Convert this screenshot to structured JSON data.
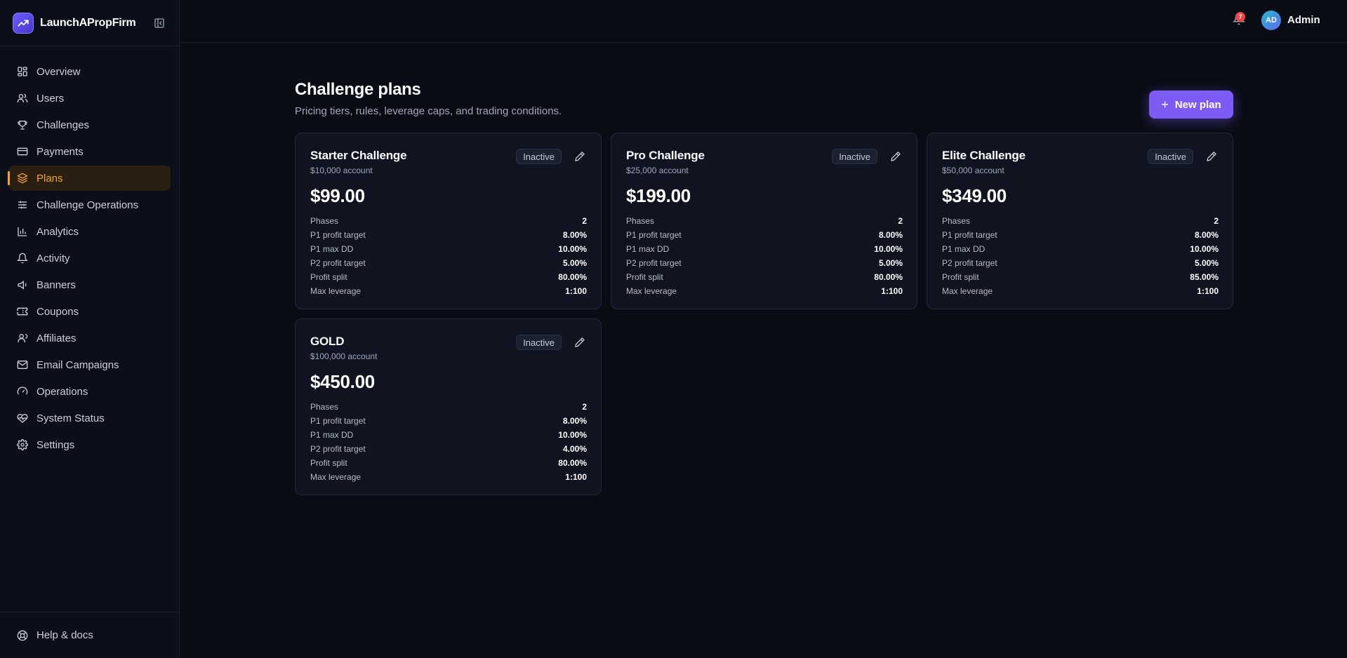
{
  "brand": {
    "name": "LaunchAPropFirm"
  },
  "sidebar": {
    "items": [
      {
        "label": "Overview",
        "icon": "grid-icon"
      },
      {
        "label": "Users",
        "icon": "users-icon"
      },
      {
        "label": "Challenges",
        "icon": "trophy-icon"
      },
      {
        "label": "Payments",
        "icon": "credit-card-icon"
      },
      {
        "label": "Plans",
        "icon": "layers-icon",
        "active": true
      },
      {
        "label": "Challenge Operations",
        "icon": "sliders-icon"
      },
      {
        "label": "Analytics",
        "icon": "bar-chart-icon"
      },
      {
        "label": "Activity",
        "icon": "bell-icon"
      },
      {
        "label": "Banners",
        "icon": "megaphone-icon"
      },
      {
        "label": "Coupons",
        "icon": "ticket-icon"
      },
      {
        "label": "Affiliates",
        "icon": "user-group-icon"
      },
      {
        "label": "Email Campaigns",
        "icon": "mail-icon"
      },
      {
        "label": "Operations",
        "icon": "gauge-icon"
      },
      {
        "label": "System Status",
        "icon": "heart-pulse-icon"
      },
      {
        "label": "Settings",
        "icon": "gear-icon"
      }
    ],
    "help_label": "Help & docs"
  },
  "topbar": {
    "notification_count": "7",
    "avatar_initials": "AD",
    "user_name": "Admin"
  },
  "main": {
    "title": "Challenge plans",
    "subtitle": "Pricing tiers, rules, leverage caps, and trading conditions.",
    "new_plan_label": "New plan",
    "plans": [
      {
        "name": "Starter Challenge",
        "account": "$10,000 account",
        "status": "Inactive",
        "price": "$99.00",
        "rows": [
          {
            "label": "Phases",
            "value": "2"
          },
          {
            "label": "P1 profit target",
            "value": "8.00%"
          },
          {
            "label": "P1 max DD",
            "value": "10.00%"
          },
          {
            "label": "P2 profit target",
            "value": "5.00%"
          },
          {
            "label": "Profit split",
            "value": "80.00%"
          },
          {
            "label": "Max leverage",
            "value": "1:100"
          }
        ]
      },
      {
        "name": "Pro Challenge",
        "account": "$25,000 account",
        "status": "Inactive",
        "price": "$199.00",
        "rows": [
          {
            "label": "Phases",
            "value": "2"
          },
          {
            "label": "P1 profit target",
            "value": "8.00%"
          },
          {
            "label": "P1 max DD",
            "value": "10.00%"
          },
          {
            "label": "P2 profit target",
            "value": "5.00%"
          },
          {
            "label": "Profit split",
            "value": "80.00%"
          },
          {
            "label": "Max leverage",
            "value": "1:100"
          }
        ]
      },
      {
        "name": "Elite Challenge",
        "account": "$50,000 account",
        "status": "Inactive",
        "price": "$349.00",
        "rows": [
          {
            "label": "Phases",
            "value": "2"
          },
          {
            "label": "P1 profit target",
            "value": "8.00%"
          },
          {
            "label": "P1 max DD",
            "value": "10.00%"
          },
          {
            "label": "P2 profit target",
            "value": "5.00%"
          },
          {
            "label": "Profit split",
            "value": "85.00%"
          },
          {
            "label": "Max leverage",
            "value": "1:100"
          }
        ]
      },
      {
        "name": "GOLD",
        "account": "$100,000 account",
        "status": "Inactive",
        "price": "$450.00",
        "rows": [
          {
            "label": "Phases",
            "value": "2"
          },
          {
            "label": "P1 profit target",
            "value": "8.00%"
          },
          {
            "label": "P1 max DD",
            "value": "10.00%"
          },
          {
            "label": "P2 profit target",
            "value": "4.00%"
          },
          {
            "label": "Profit split",
            "value": "80.00%"
          },
          {
            "label": "Max leverage",
            "value": "1:100"
          }
        ]
      }
    ]
  },
  "colors": {
    "accent": "#7c5cf5",
    "active_nav": "#f5a524",
    "badge": "#ef4444",
    "background": "#090c14"
  }
}
